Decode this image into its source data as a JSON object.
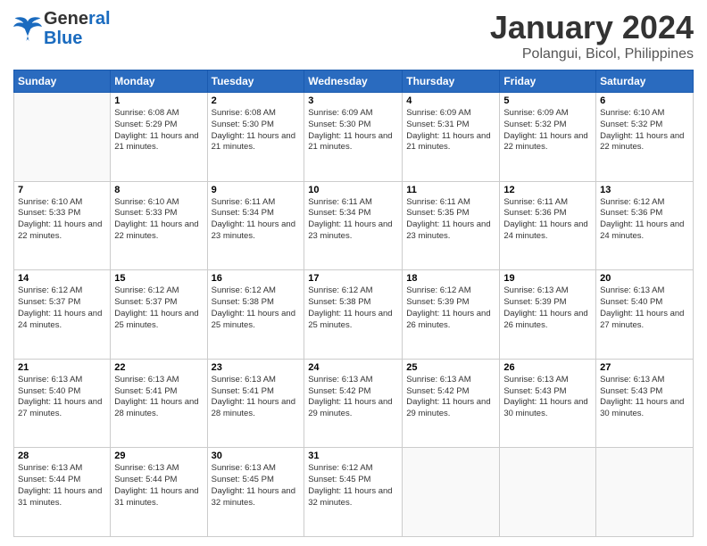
{
  "header": {
    "month_title": "January 2024",
    "location": "Polangui, Bicol, Philippines",
    "logo_line1": "General",
    "logo_line2": "Blue"
  },
  "days_of_week": [
    "Sunday",
    "Monday",
    "Tuesday",
    "Wednesday",
    "Thursday",
    "Friday",
    "Saturday"
  ],
  "weeks": [
    [
      {
        "day": "",
        "sunrise": "",
        "sunset": "",
        "daylight": ""
      },
      {
        "day": "1",
        "sunrise": "Sunrise: 6:08 AM",
        "sunset": "Sunset: 5:29 PM",
        "daylight": "Daylight: 11 hours and 21 minutes."
      },
      {
        "day": "2",
        "sunrise": "Sunrise: 6:08 AM",
        "sunset": "Sunset: 5:30 PM",
        "daylight": "Daylight: 11 hours and 21 minutes."
      },
      {
        "day": "3",
        "sunrise": "Sunrise: 6:09 AM",
        "sunset": "Sunset: 5:30 PM",
        "daylight": "Daylight: 11 hours and 21 minutes."
      },
      {
        "day": "4",
        "sunrise": "Sunrise: 6:09 AM",
        "sunset": "Sunset: 5:31 PM",
        "daylight": "Daylight: 11 hours and 21 minutes."
      },
      {
        "day": "5",
        "sunrise": "Sunrise: 6:09 AM",
        "sunset": "Sunset: 5:32 PM",
        "daylight": "Daylight: 11 hours and 22 minutes."
      },
      {
        "day": "6",
        "sunrise": "Sunrise: 6:10 AM",
        "sunset": "Sunset: 5:32 PM",
        "daylight": "Daylight: 11 hours and 22 minutes."
      }
    ],
    [
      {
        "day": "7",
        "sunrise": "Sunrise: 6:10 AM",
        "sunset": "Sunset: 5:33 PM",
        "daylight": "Daylight: 11 hours and 22 minutes."
      },
      {
        "day": "8",
        "sunrise": "Sunrise: 6:10 AM",
        "sunset": "Sunset: 5:33 PM",
        "daylight": "Daylight: 11 hours and 22 minutes."
      },
      {
        "day": "9",
        "sunrise": "Sunrise: 6:11 AM",
        "sunset": "Sunset: 5:34 PM",
        "daylight": "Daylight: 11 hours and 23 minutes."
      },
      {
        "day": "10",
        "sunrise": "Sunrise: 6:11 AM",
        "sunset": "Sunset: 5:34 PM",
        "daylight": "Daylight: 11 hours and 23 minutes."
      },
      {
        "day": "11",
        "sunrise": "Sunrise: 6:11 AM",
        "sunset": "Sunset: 5:35 PM",
        "daylight": "Daylight: 11 hours and 23 minutes."
      },
      {
        "day": "12",
        "sunrise": "Sunrise: 6:11 AM",
        "sunset": "Sunset: 5:36 PM",
        "daylight": "Daylight: 11 hours and 24 minutes."
      },
      {
        "day": "13",
        "sunrise": "Sunrise: 6:12 AM",
        "sunset": "Sunset: 5:36 PM",
        "daylight": "Daylight: 11 hours and 24 minutes."
      }
    ],
    [
      {
        "day": "14",
        "sunrise": "Sunrise: 6:12 AM",
        "sunset": "Sunset: 5:37 PM",
        "daylight": "Daylight: 11 hours and 24 minutes."
      },
      {
        "day": "15",
        "sunrise": "Sunrise: 6:12 AM",
        "sunset": "Sunset: 5:37 PM",
        "daylight": "Daylight: 11 hours and 25 minutes."
      },
      {
        "day": "16",
        "sunrise": "Sunrise: 6:12 AM",
        "sunset": "Sunset: 5:38 PM",
        "daylight": "Daylight: 11 hours and 25 minutes."
      },
      {
        "day": "17",
        "sunrise": "Sunrise: 6:12 AM",
        "sunset": "Sunset: 5:38 PM",
        "daylight": "Daylight: 11 hours and 25 minutes."
      },
      {
        "day": "18",
        "sunrise": "Sunrise: 6:12 AM",
        "sunset": "Sunset: 5:39 PM",
        "daylight": "Daylight: 11 hours and 26 minutes."
      },
      {
        "day": "19",
        "sunrise": "Sunrise: 6:13 AM",
        "sunset": "Sunset: 5:39 PM",
        "daylight": "Daylight: 11 hours and 26 minutes."
      },
      {
        "day": "20",
        "sunrise": "Sunrise: 6:13 AM",
        "sunset": "Sunset: 5:40 PM",
        "daylight": "Daylight: 11 hours and 27 minutes."
      }
    ],
    [
      {
        "day": "21",
        "sunrise": "Sunrise: 6:13 AM",
        "sunset": "Sunset: 5:40 PM",
        "daylight": "Daylight: 11 hours and 27 minutes."
      },
      {
        "day": "22",
        "sunrise": "Sunrise: 6:13 AM",
        "sunset": "Sunset: 5:41 PM",
        "daylight": "Daylight: 11 hours and 28 minutes."
      },
      {
        "day": "23",
        "sunrise": "Sunrise: 6:13 AM",
        "sunset": "Sunset: 5:41 PM",
        "daylight": "Daylight: 11 hours and 28 minutes."
      },
      {
        "day": "24",
        "sunrise": "Sunrise: 6:13 AM",
        "sunset": "Sunset: 5:42 PM",
        "daylight": "Daylight: 11 hours and 29 minutes."
      },
      {
        "day": "25",
        "sunrise": "Sunrise: 6:13 AM",
        "sunset": "Sunset: 5:42 PM",
        "daylight": "Daylight: 11 hours and 29 minutes."
      },
      {
        "day": "26",
        "sunrise": "Sunrise: 6:13 AM",
        "sunset": "Sunset: 5:43 PM",
        "daylight": "Daylight: 11 hours and 30 minutes."
      },
      {
        "day": "27",
        "sunrise": "Sunrise: 6:13 AM",
        "sunset": "Sunset: 5:43 PM",
        "daylight": "Daylight: 11 hours and 30 minutes."
      }
    ],
    [
      {
        "day": "28",
        "sunrise": "Sunrise: 6:13 AM",
        "sunset": "Sunset: 5:44 PM",
        "daylight": "Daylight: 11 hours and 31 minutes."
      },
      {
        "day": "29",
        "sunrise": "Sunrise: 6:13 AM",
        "sunset": "Sunset: 5:44 PM",
        "daylight": "Daylight: 11 hours and 31 minutes."
      },
      {
        "day": "30",
        "sunrise": "Sunrise: 6:13 AM",
        "sunset": "Sunset: 5:45 PM",
        "daylight": "Daylight: 11 hours and 32 minutes."
      },
      {
        "day": "31",
        "sunrise": "Sunrise: 6:12 AM",
        "sunset": "Sunset: 5:45 PM",
        "daylight": "Daylight: 11 hours and 32 minutes."
      },
      {
        "day": "",
        "sunrise": "",
        "sunset": "",
        "daylight": ""
      },
      {
        "day": "",
        "sunrise": "",
        "sunset": "",
        "daylight": ""
      },
      {
        "day": "",
        "sunrise": "",
        "sunset": "",
        "daylight": ""
      }
    ]
  ]
}
